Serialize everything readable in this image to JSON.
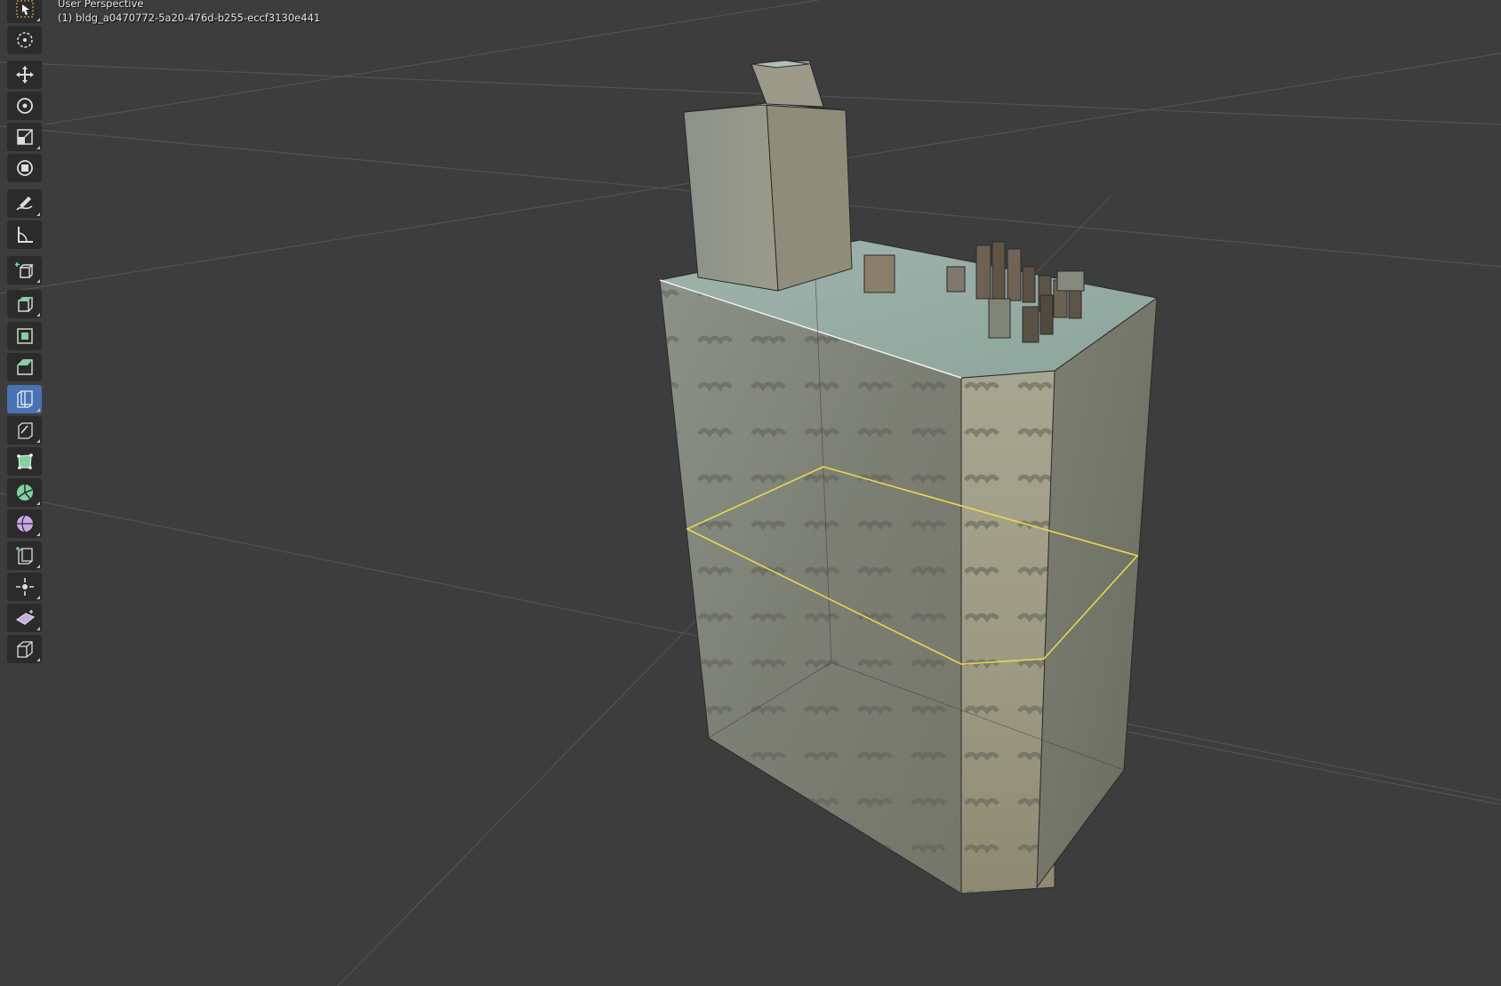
{
  "viewport": {
    "view_name": "User Perspective",
    "object_name": "(1) bldg_a0470772-5a20-476d-b255-eccf3130e441",
    "background_color": "#3d3d3d",
    "grid_color": "#555555",
    "selection_color": "#e8d84a"
  },
  "toolbar": {
    "active_tool": "loop-cut",
    "tools": [
      {
        "name": "select-box-icon",
        "has_submenu": true
      },
      {
        "name": "cursor-icon",
        "has_submenu": false
      },
      {
        "name": "move-icon",
        "has_submenu": false
      },
      {
        "name": "rotate-icon",
        "has_submenu": false
      },
      {
        "name": "scale-icon",
        "has_submenu": true
      },
      {
        "name": "transform-icon",
        "has_submenu": false
      },
      {
        "name": "annotate-icon",
        "has_submenu": true
      },
      {
        "name": "measure-icon",
        "has_submenu": false
      },
      {
        "name": "add-cube-icon",
        "has_submenu": true
      },
      {
        "name": "extrude-region-icon",
        "has_submenu": true
      },
      {
        "name": "inset-faces-icon",
        "has_submenu": false
      },
      {
        "name": "bevel-icon",
        "has_submenu": false
      },
      {
        "name": "loop-cut-icon",
        "has_submenu": true
      },
      {
        "name": "knife-icon",
        "has_submenu": true
      },
      {
        "name": "poly-build-icon",
        "has_submenu": false
      },
      {
        "name": "spin-icon",
        "has_submenu": true
      },
      {
        "name": "smooth-icon",
        "has_submenu": true
      },
      {
        "name": "edge-slide-icon",
        "has_submenu": true
      },
      {
        "name": "shrink-fatten-icon",
        "has_submenu": true
      },
      {
        "name": "shear-icon",
        "has_submenu": true
      },
      {
        "name": "rip-region-icon",
        "has_submenu": true
      }
    ]
  }
}
